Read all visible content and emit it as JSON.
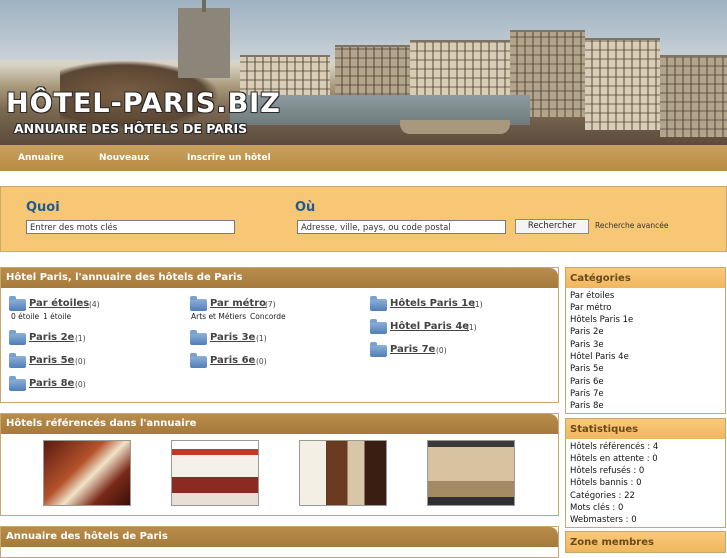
{
  "header": {
    "brand": "HÔTEL-PARIS.BIZ",
    "tagline": "ANNUAIRE DES HÔTELS DE PARIS"
  },
  "nav": {
    "items": [
      "Annuaire",
      "Nouveaux",
      "Inscrire un hôtel"
    ]
  },
  "search": {
    "what_label": "Quoi",
    "what_value": "Entrer des mots clés",
    "where_label": "Où",
    "where_value": "Adresse, ville, pays, ou code postal",
    "button": "Rechercher",
    "advanced": "Recherche avancée"
  },
  "directory": {
    "title": "Hôtel Paris, l'annuaire des hôtels de Paris",
    "categories": [
      {
        "name": "Par étoiles",
        "count": "(4)"
      },
      {
        "name": "Par métro",
        "count": "(7)"
      },
      {
        "name": "Hôtels Paris 1e",
        "count": "(1)"
      },
      {
        "name": "Paris 2e",
        "count": "(1)"
      },
      {
        "name": "Paris 3e",
        "count": "(1)"
      },
      {
        "name": "Hôtel Paris 4e",
        "count": "(1)"
      },
      {
        "name": "Paris 5e",
        "count": "(0)"
      },
      {
        "name": "Paris 6e",
        "count": "(0)"
      },
      {
        "name": "Paris 7e",
        "count": "(0)"
      },
      {
        "name": "Paris 8e",
        "count": "(0)"
      }
    ],
    "subs_etoiles": [
      "0 étoile",
      "1 étoile"
    ],
    "subs_metro": [
      "Arts et Métiers",
      "Concorde"
    ]
  },
  "featured": {
    "title": "Hôtels référencés dans l'annuaire"
  },
  "bottom": {
    "title": "Annuaire des hôtels de Paris"
  },
  "sidebar": {
    "categories_title": "Catégories",
    "categories": [
      "Par étoiles",
      "Par métro",
      "Hôtels Paris 1e",
      "Paris 2e",
      "Paris 3e",
      "Hôtel Paris 4e",
      "Paris 5e",
      "Paris 6e",
      "Paris 7e",
      "Paris 8e"
    ],
    "stats_title": "Statistiques",
    "stats": [
      "Hôtels référencés : 4",
      "Hôtels en attente : 0",
      "Hôtels refusés : 0",
      "Hôtels bannis : 0",
      "Catégories : 22",
      "Mots clés : 0",
      "Webmasters : 0"
    ],
    "members_title": "Zone membres"
  }
}
